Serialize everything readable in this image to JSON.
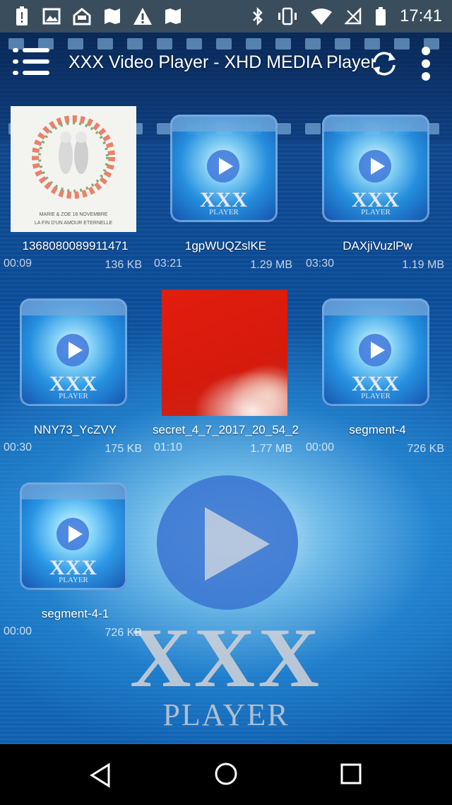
{
  "status_bar": {
    "time": "17:41",
    "left_icons": [
      "battery-alert-icon",
      "image-icon",
      "inbox-icon",
      "map-icon",
      "warning-icon",
      "map-icon"
    ],
    "right_icons": [
      "bluetooth-icon",
      "vibrate-icon",
      "wifi-icon",
      "no-signal-icon",
      "battery-icon"
    ]
  },
  "toolbar": {
    "title": "XXX Video Player - XHD MEDIA Player",
    "menu_icon": "hamburger-icon",
    "refresh_icon": "refresh-icon",
    "more_icon": "more-vert-icon"
  },
  "videos": [
    {
      "name": "1368080089911471",
      "duration": "00:09",
      "size": "136 KB",
      "thumb": "wreath"
    },
    {
      "name": "1gpWUQZslKE",
      "duration": "03:21",
      "size": "1.29 MB",
      "thumb": "default"
    },
    {
      "name": "DAXjiVuzlPw",
      "duration": "03:30",
      "size": "1.19 MB",
      "thumb": "default"
    },
    {
      "name": "NNY73_YcZVY",
      "duration": "00:30",
      "size": "175 KB",
      "thumb": "default"
    },
    {
      "name": "secret_4_7_2017_20_54_2",
      "duration": "01:10",
      "size": "1.77 MB",
      "thumb": "red"
    },
    {
      "name": "segment-4",
      "duration": "00:00",
      "size": "726 KB",
      "thumb": "default"
    },
    {
      "name": "segment-4-1",
      "duration": "00:00",
      "size": "726 KB",
      "thumb": "default"
    }
  ],
  "default_thumb": {
    "logo": "XXX",
    "sub": "PLAYER"
  },
  "background": {
    "logo": "XXX",
    "sub": "PLAYER"
  },
  "wreath_thumb": {
    "line1": "MARIE & ZOE 16 NOVEMBRE",
    "line2": "LA FIN D'UN AMOUR ETERNELLE"
  },
  "nav_bar": {
    "back_icon": "back-icon",
    "home_icon": "home-icon",
    "recents_icon": "recents-icon"
  }
}
